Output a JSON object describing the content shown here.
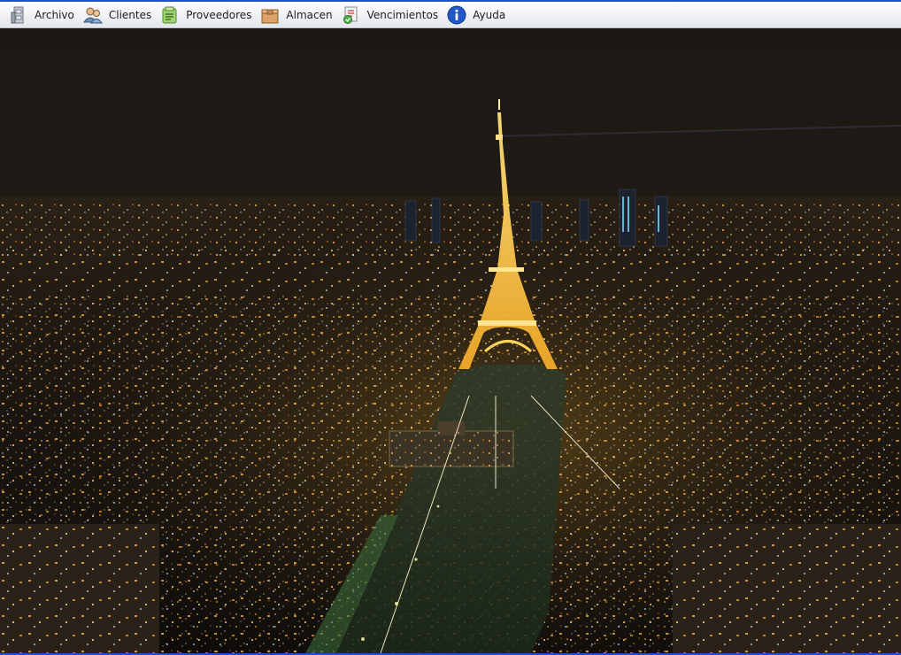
{
  "menubar": {
    "items": [
      {
        "label": "Archivo",
        "icon": "archive-cabinet-icon"
      },
      {
        "label": "Clientes",
        "icon": "clients-users-icon"
      },
      {
        "label": "Proveedores",
        "icon": "suppliers-icon"
      },
      {
        "label": "Almacen",
        "icon": "warehouse-box-icon"
      },
      {
        "label": "Vencimientos",
        "icon": "due-dates-icon"
      },
      {
        "label": "Ayuda",
        "icon": "info-help-icon"
      }
    ]
  },
  "colors": {
    "window_border": "#1c4fd6",
    "menubar_bg": "#eef0f3",
    "night_sky": "#1a1612",
    "city_lights": "#f5a623",
    "tower_gold": "#ffcc33"
  }
}
